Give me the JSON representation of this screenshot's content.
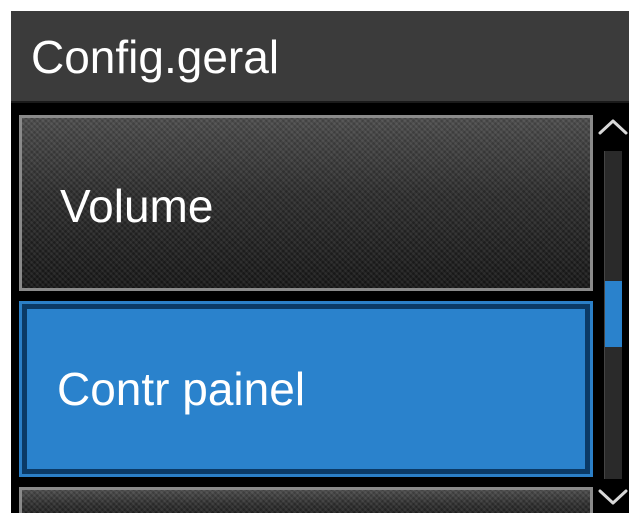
{
  "screen": {
    "title": "Config.geral"
  },
  "menu": {
    "items": [
      {
        "label": "Volume",
        "selected": false
      },
      {
        "label": "Contr painel",
        "selected": true
      },
      {
        "label": "",
        "selected": false
      }
    ]
  },
  "scrollbar": {
    "up_icon": "chevron-up-icon",
    "down_icon": "chevron-down-icon",
    "position_fraction": 0.4
  },
  "colors": {
    "title_bar": "#3b3b3b",
    "selection": "#2a82cc",
    "item_border": "#8a8a8a",
    "background": "#000000"
  }
}
